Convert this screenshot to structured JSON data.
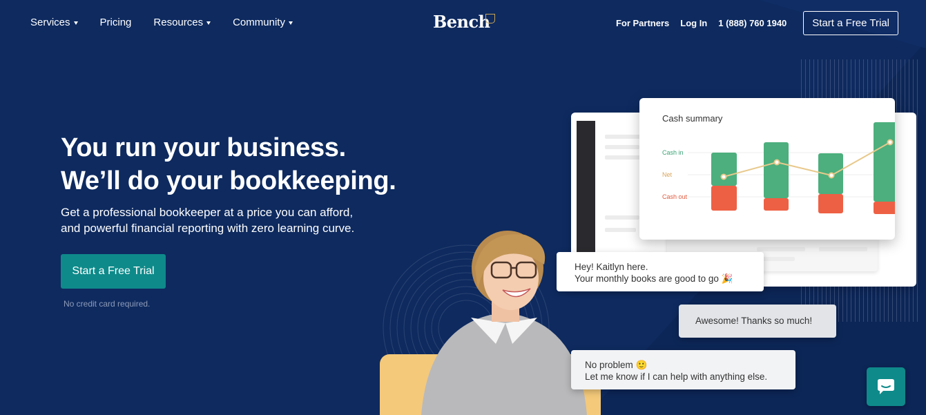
{
  "nav": {
    "left_items": [
      {
        "label": "Services",
        "has_caret": true
      },
      {
        "label": "Pricing",
        "has_caret": false
      },
      {
        "label": "Resources",
        "has_caret": true
      },
      {
        "label": "Community",
        "has_caret": true
      }
    ],
    "logo_text": "Bench",
    "for_partners": "For Partners",
    "login": "Log In",
    "phone": "1 (888) 760 1940",
    "cta": "Start a Free Trial"
  },
  "hero": {
    "title_line1": "You run your business.",
    "title_line2": "We’ll do your bookkeeping.",
    "subtitle_line1": "Get a professional bookkeeper at a price you can afford,",
    "subtitle_line2": "and powerful financial reporting with zero learning curve.",
    "cta": "Start a Free Trial",
    "note": "No credit card required."
  },
  "cash_summary": {
    "title": "Cash summary",
    "legend": {
      "cash_in": "Cash in",
      "net": "Net",
      "cash_out": "Cash out"
    },
    "colors": {
      "cash_in": "#4caf7d",
      "net": "#e8c98c",
      "cash_out": "#ee6044"
    }
  },
  "chat": {
    "msg1_line1": "Hey! Kaitlyn here.",
    "msg1_line2": "Your monthly books are good to go 🎉",
    "msg2": "Awesome! Thanks so much!",
    "msg3_line1": "No problem 🙂",
    "msg3_line2": "Let me know if I can help with anything else."
  },
  "icons": {
    "chat_launcher": "chat-bubble-icon",
    "logo_mark": "shield-icon"
  },
  "colors": {
    "background": "#0e2a5f",
    "accent": "#0e8a8a"
  }
}
